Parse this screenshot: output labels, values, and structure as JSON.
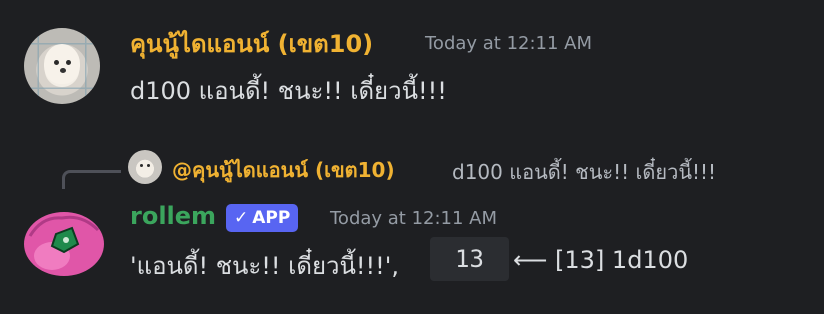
{
  "message1": {
    "author": "คุนนู้ไดแอนน์ (เขต10)",
    "timestamp": "Today at 12:11 AM",
    "content": "d100 แอนดี้! ชนะ!! เดี๋ยวนี้!!!"
  },
  "reply": {
    "mention": "@คุนนู้ไดแอนน์ (เขต10)",
    "preview": "d100 แอนดี้! ชนะ!! เดี๋ยวนี้!!!"
  },
  "message2": {
    "author": "rollem",
    "badge_label": "APP",
    "badge_check": "✓",
    "timestamp": "Today at 12:11 AM",
    "content_prefix": "'แอนดี้! ชนะ!! เดี๋ยวนี้!!!',",
    "roll_total": "13",
    "roll_detail": "⟵ [13] 1d100"
  },
  "colors": {
    "background": "#1e1f22",
    "author1": "#f0b232",
    "author2": "#3ba55d",
    "badge": "#5865f2",
    "timestamp": "#949ba4"
  },
  "icons": {
    "avatar1": "pomeranian-dog-avatar",
    "avatar2": "pink-dice-avatar"
  }
}
